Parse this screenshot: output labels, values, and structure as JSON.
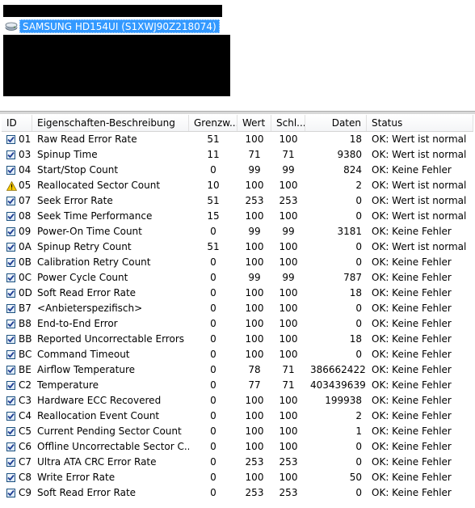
{
  "drive": {
    "label": "SAMSUNG HD154UI (S1XWJ90Z218074)"
  },
  "columns": {
    "id": "ID",
    "desc": "Eigenschaften-Beschreibung",
    "grenz": "Grenzw...",
    "wert": "Wert",
    "schl": "Schl...",
    "daten": "Daten",
    "status": "Status"
  },
  "rows": [
    {
      "icon": "check",
      "id": "01",
      "desc": "Raw Read Error Rate",
      "grenz": "51",
      "wert": "100",
      "schl": "100",
      "daten": "18",
      "status": "OK: Wert ist normal"
    },
    {
      "icon": "check",
      "id": "03",
      "desc": "Spinup Time",
      "grenz": "11",
      "wert": "71",
      "schl": "71",
      "daten": "9380",
      "status": "OK: Wert ist normal"
    },
    {
      "icon": "check",
      "id": "04",
      "desc": "Start/Stop Count",
      "grenz": "0",
      "wert": "99",
      "schl": "99",
      "daten": "824",
      "status": "OK: Keine Fehler"
    },
    {
      "icon": "warning",
      "id": "05",
      "desc": "Reallocated Sector Count",
      "grenz": "10",
      "wert": "100",
      "schl": "100",
      "daten": "2",
      "status": "OK: Wert ist normal"
    },
    {
      "icon": "check",
      "id": "07",
      "desc": "Seek Error Rate",
      "grenz": "51",
      "wert": "253",
      "schl": "253",
      "daten": "0",
      "status": "OK: Wert ist normal"
    },
    {
      "icon": "check",
      "id": "08",
      "desc": "Seek Time Performance",
      "grenz": "15",
      "wert": "100",
      "schl": "100",
      "daten": "0",
      "status": "OK: Wert ist normal"
    },
    {
      "icon": "check",
      "id": "09",
      "desc": "Power-On Time Count",
      "grenz": "0",
      "wert": "99",
      "schl": "99",
      "daten": "3181",
      "status": "OK: Keine Fehler"
    },
    {
      "icon": "check",
      "id": "0A",
      "desc": "Spinup Retry Count",
      "grenz": "51",
      "wert": "100",
      "schl": "100",
      "daten": "0",
      "status": "OK: Wert ist normal"
    },
    {
      "icon": "check",
      "id": "0B",
      "desc": "Calibration Retry Count",
      "grenz": "0",
      "wert": "100",
      "schl": "100",
      "daten": "0",
      "status": "OK: Keine Fehler"
    },
    {
      "icon": "check",
      "id": "0C",
      "desc": "Power Cycle Count",
      "grenz": "0",
      "wert": "99",
      "schl": "99",
      "daten": "787",
      "status": "OK: Keine Fehler"
    },
    {
      "icon": "check",
      "id": "0D",
      "desc": "Soft Read Error Rate",
      "grenz": "0",
      "wert": "100",
      "schl": "100",
      "daten": "18",
      "status": "OK: Keine Fehler"
    },
    {
      "icon": "check",
      "id": "B7",
      "desc": "<Anbieterspezifisch>",
      "grenz": "0",
      "wert": "100",
      "schl": "100",
      "daten": "0",
      "status": "OK: Keine Fehler"
    },
    {
      "icon": "check",
      "id": "B8",
      "desc": "End-to-End Error",
      "grenz": "0",
      "wert": "100",
      "schl": "100",
      "daten": "0",
      "status": "OK: Keine Fehler"
    },
    {
      "icon": "check",
      "id": "BB",
      "desc": "Reported Uncorrectable Errors",
      "grenz": "0",
      "wert": "100",
      "schl": "100",
      "daten": "18",
      "status": "OK: Keine Fehler"
    },
    {
      "icon": "check",
      "id": "BC",
      "desc": "Command Timeout",
      "grenz": "0",
      "wert": "100",
      "schl": "100",
      "daten": "0",
      "status": "OK: Keine Fehler"
    },
    {
      "icon": "check",
      "id": "BE",
      "desc": "Airflow Temperature",
      "grenz": "0",
      "wert": "78",
      "schl": "71",
      "daten": "386662422",
      "status": "OK: Keine Fehler"
    },
    {
      "icon": "check",
      "id": "C2",
      "desc": "Temperature",
      "grenz": "0",
      "wert": "77",
      "schl": "71",
      "daten": "403439639",
      "status": "OK: Keine Fehler"
    },
    {
      "icon": "check",
      "id": "C3",
      "desc": "Hardware ECC Recovered",
      "grenz": "0",
      "wert": "100",
      "schl": "100",
      "daten": "199938",
      "status": "OK: Keine Fehler"
    },
    {
      "icon": "check",
      "id": "C4",
      "desc": "Reallocation Event Count",
      "grenz": "0",
      "wert": "100",
      "schl": "100",
      "daten": "2",
      "status": "OK: Keine Fehler"
    },
    {
      "icon": "check",
      "id": "C5",
      "desc": "Current Pending Sector Count",
      "grenz": "0",
      "wert": "100",
      "schl": "100",
      "daten": "1",
      "status": "OK: Keine Fehler"
    },
    {
      "icon": "check",
      "id": "C6",
      "desc": "Offline Uncorrectable Sector C...",
      "grenz": "0",
      "wert": "100",
      "schl": "100",
      "daten": "0",
      "status": "OK: Keine Fehler"
    },
    {
      "icon": "check",
      "id": "C7",
      "desc": "Ultra ATA CRC Error Rate",
      "grenz": "0",
      "wert": "253",
      "schl": "253",
      "daten": "0",
      "status": "OK: Keine Fehler"
    },
    {
      "icon": "check",
      "id": "C8",
      "desc": "Write Error Rate",
      "grenz": "0",
      "wert": "100",
      "schl": "100",
      "daten": "50",
      "status": "OK: Keine Fehler"
    },
    {
      "icon": "check",
      "id": "C9",
      "desc": "Soft Read Error Rate",
      "grenz": "0",
      "wert": "253",
      "schl": "253",
      "daten": "0",
      "status": "OK: Keine Fehler"
    }
  ]
}
